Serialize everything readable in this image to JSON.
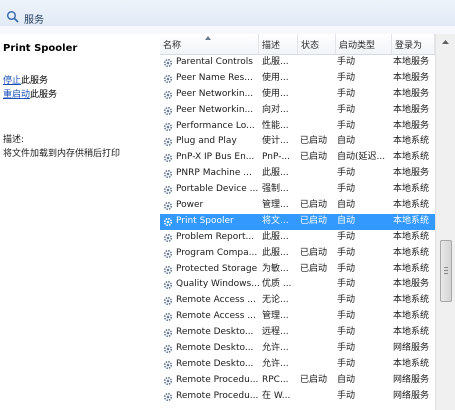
{
  "window": {
    "title": "服务"
  },
  "left_panel": {
    "service_name": "Print Spooler",
    "stop_link": "停止",
    "stop_suffix": "此服务",
    "restart_link": "重启动",
    "restart_suffix": "此服务",
    "description_label": "描述:",
    "description_text": "将文件加载到内存供稍后打印"
  },
  "columns": [
    "名称",
    "描述",
    "状态",
    "启动类型",
    "登录为"
  ],
  "rows": [
    {
      "name": "Parental Controls",
      "desc": "此服...",
      "status": "",
      "startup": "手动",
      "logon": "本地服务"
    },
    {
      "name": "Peer Name Res...",
      "desc": "使用...",
      "status": "",
      "startup": "手动",
      "logon": "本地服务"
    },
    {
      "name": "Peer Networkin...",
      "desc": "使用...",
      "status": "",
      "startup": "手动",
      "logon": "本地服务"
    },
    {
      "name": "Peer Networkin...",
      "desc": "向对...",
      "status": "",
      "startup": "手动",
      "logon": "本地服务"
    },
    {
      "name": "Performance Lo...",
      "desc": "性能...",
      "status": "",
      "startup": "手动",
      "logon": "本地服务"
    },
    {
      "name": "Plug and Play",
      "desc": "使计...",
      "status": "已启动",
      "startup": "自动",
      "logon": "本地系统"
    },
    {
      "name": "PnP-X IP Bus En...",
      "desc": "PnP-...",
      "status": "已启动",
      "startup": "自动(延迟...",
      "logon": "本地系统"
    },
    {
      "name": "PNRP Machine ...",
      "desc": "此服...",
      "status": "",
      "startup": "手动",
      "logon": "本地服务"
    },
    {
      "name": "Portable Device ...",
      "desc": "强制...",
      "status": "",
      "startup": "手动",
      "logon": "本地系统"
    },
    {
      "name": "Power",
      "desc": "管理...",
      "status": "已启动",
      "startup": "自动",
      "logon": "本地系统"
    },
    {
      "name": "Print Spooler",
      "desc": "将文...",
      "status": "已启动",
      "startup": "自动",
      "logon": "本地系统",
      "selected": true
    },
    {
      "name": "Problem Report...",
      "desc": "此服...",
      "status": "",
      "startup": "手动",
      "logon": "本地系统"
    },
    {
      "name": "Program Compa...",
      "desc": "此服...",
      "status": "已启动",
      "startup": "手动",
      "logon": "本地系统"
    },
    {
      "name": "Protected Storage",
      "desc": "为敏...",
      "status": "已启动",
      "startup": "手动",
      "logon": "本地系统"
    },
    {
      "name": "Quality Windows...",
      "desc": "优质 ...",
      "status": "",
      "startup": "手动",
      "logon": "本地服务"
    },
    {
      "name": "Remote Access ...",
      "desc": "无论...",
      "status": "",
      "startup": "手动",
      "logon": "本地系统"
    },
    {
      "name": "Remote Access ...",
      "desc": "管理...",
      "status": "",
      "startup": "手动",
      "logon": "本地系统"
    },
    {
      "name": "Remote Deskto...",
      "desc": "远程...",
      "status": "",
      "startup": "手动",
      "logon": "本地系统"
    },
    {
      "name": "Remote Deskto...",
      "desc": "允许...",
      "status": "",
      "startup": "手动",
      "logon": "网络服务"
    },
    {
      "name": "Remote Deskto...",
      "desc": "允许...",
      "status": "",
      "startup": "手动",
      "logon": "本地系统"
    },
    {
      "name": "Remote Procedu...",
      "desc": "RPC...",
      "status": "已启动",
      "startup": "自动",
      "logon": "网络服务"
    },
    {
      "name": "Remote Procedu...",
      "desc": "在 W...",
      "status": "",
      "startup": "手动",
      "logon": "网络服务"
    }
  ],
  "icons": {
    "row_icon": "gear-icon",
    "title_icon": "search-icon"
  },
  "colors": {
    "selected_bg": "#3399ff",
    "link": "#1a4fb8"
  }
}
